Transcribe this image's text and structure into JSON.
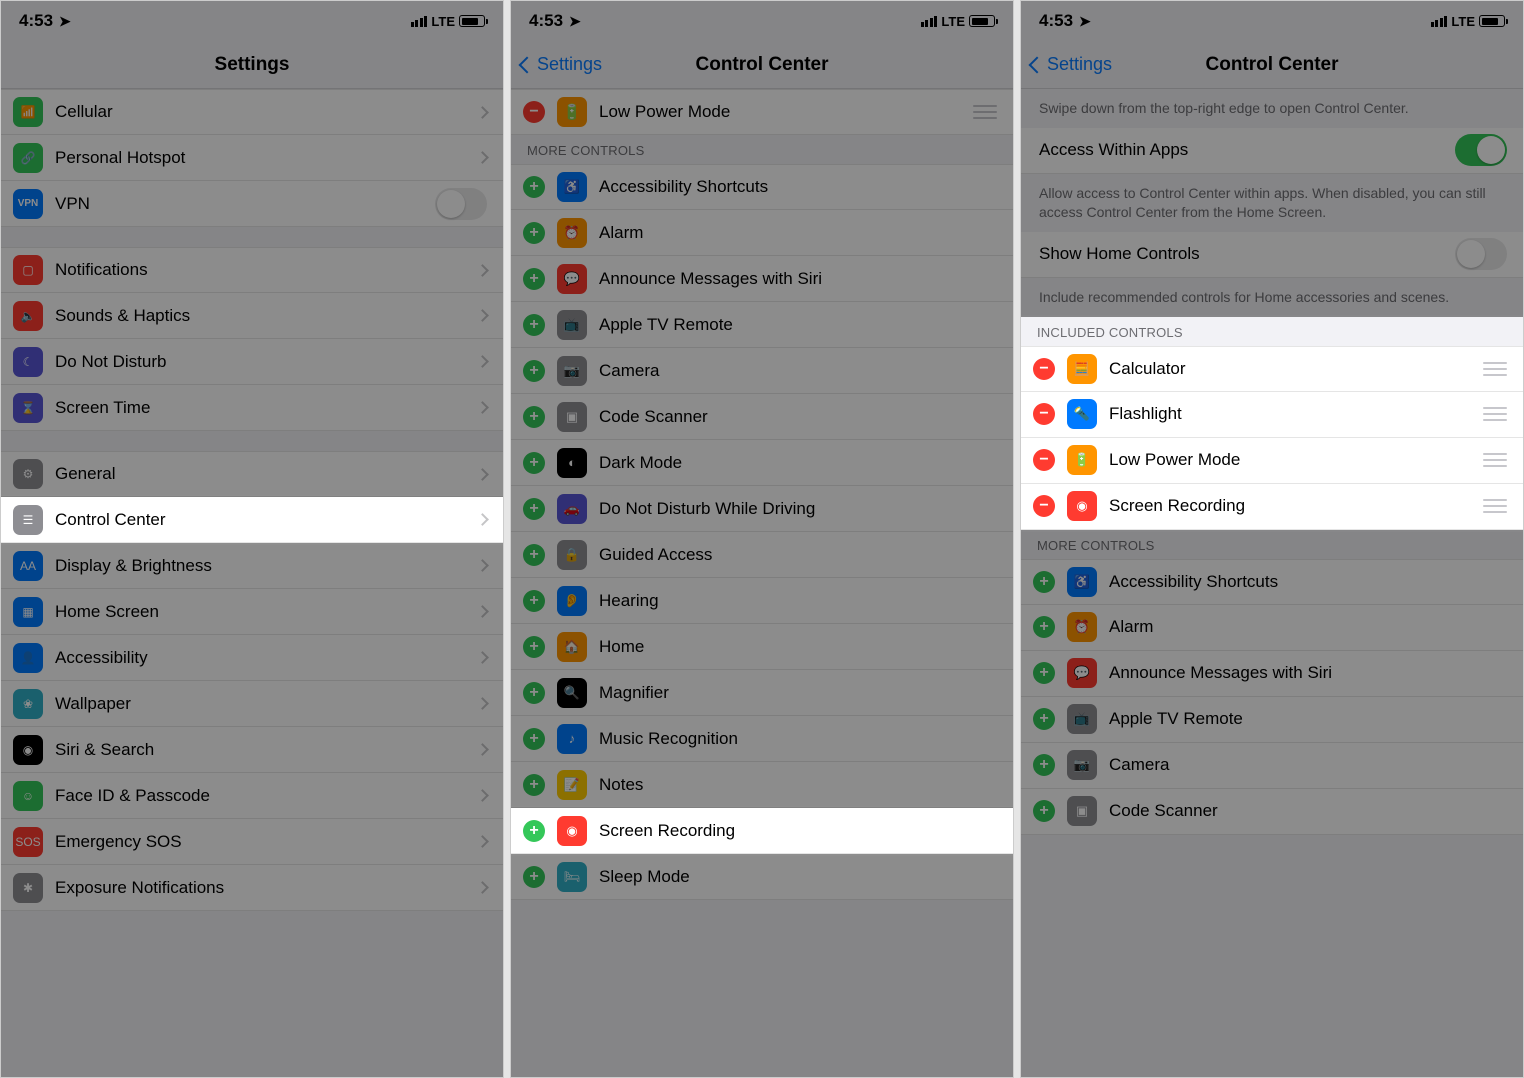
{
  "statusbar": {
    "time": "4:53",
    "network": "LTE"
  },
  "phone1": {
    "title": "Settings",
    "rows1": [
      {
        "label": "Cellular",
        "icon_bg": "ic-green",
        "glyph": "📶"
      },
      {
        "label": "Personal Hotspot",
        "icon_bg": "ic-green",
        "glyph": "🔗"
      }
    ],
    "vpn_label": "VPN",
    "vpn_glyph": "VPN",
    "rows2": [
      {
        "label": "Notifications",
        "icon_bg": "ic-red",
        "glyph": "▢"
      },
      {
        "label": "Sounds & Haptics",
        "icon_bg": "ic-red",
        "glyph": "🔈"
      },
      {
        "label": "Do Not Disturb",
        "icon_bg": "ic-purple",
        "glyph": "☾"
      },
      {
        "label": "Screen Time",
        "icon_bg": "ic-purple",
        "glyph": "⌛"
      }
    ],
    "rows3": [
      {
        "label": "General",
        "icon_bg": "ic-grey",
        "glyph": "⚙"
      },
      {
        "label": "Control Center",
        "icon_bg": "ic-grey",
        "glyph": "☰"
      },
      {
        "label": "Display & Brightness",
        "icon_bg": "ic-blue",
        "glyph": "AA"
      },
      {
        "label": "Home Screen",
        "icon_bg": "ic-blue",
        "glyph": "▦"
      },
      {
        "label": "Accessibility",
        "icon_bg": "ic-blue",
        "glyph": "👤"
      },
      {
        "label": "Wallpaper",
        "icon_bg": "ic-teal",
        "glyph": "❀"
      },
      {
        "label": "Siri & Search",
        "icon_bg": "ic-black",
        "glyph": "◉"
      },
      {
        "label": "Face ID & Passcode",
        "icon_bg": "ic-green",
        "glyph": "☺"
      },
      {
        "label": "Emergency SOS",
        "icon_bg": "ic-red",
        "glyph": "SOS"
      },
      {
        "label": "Exposure Notifications",
        "icon_bg": "ic-grey",
        "glyph": "✱"
      }
    ],
    "highlight_index": 1
  },
  "phone2": {
    "back_label": "Settings",
    "title": "Control Center",
    "included_tail": {
      "label": "Low Power Mode",
      "icon_bg": "ic-orange",
      "glyph": "🔋"
    },
    "more_header": "MORE CONTROLS",
    "more": [
      {
        "label": "Accessibility Shortcuts",
        "icon_bg": "ic-blue",
        "glyph": "♿"
      },
      {
        "label": "Alarm",
        "icon_bg": "ic-orange",
        "glyph": "⏰"
      },
      {
        "label": "Announce Messages with Siri",
        "icon_bg": "ic-red",
        "glyph": "💬"
      },
      {
        "label": "Apple TV Remote",
        "icon_bg": "ic-grey",
        "glyph": "📺"
      },
      {
        "label": "Camera",
        "icon_bg": "ic-grey",
        "glyph": "📷"
      },
      {
        "label": "Code Scanner",
        "icon_bg": "ic-grey",
        "glyph": "▣"
      },
      {
        "label": "Dark Mode",
        "icon_bg": "ic-black",
        "glyph": "◐"
      },
      {
        "label": "Do Not Disturb While Driving",
        "icon_bg": "ic-purple",
        "glyph": "🚗"
      },
      {
        "label": "Guided Access",
        "icon_bg": "ic-grey",
        "glyph": "🔒"
      },
      {
        "label": "Hearing",
        "icon_bg": "ic-blue",
        "glyph": "👂"
      },
      {
        "label": "Home",
        "icon_bg": "ic-orange",
        "glyph": "🏠"
      },
      {
        "label": "Magnifier",
        "icon_bg": "ic-black",
        "glyph": "🔍"
      },
      {
        "label": "Music Recognition",
        "icon_bg": "ic-blue",
        "glyph": "♪"
      },
      {
        "label": "Notes",
        "icon_bg": "ic-yellow",
        "glyph": "📝"
      },
      {
        "label": "Screen Recording",
        "icon_bg": "ic-red",
        "glyph": "◉"
      },
      {
        "label": "Sleep Mode",
        "icon_bg": "ic-teal",
        "glyph": "🛏"
      }
    ],
    "highlight_index": 14
  },
  "phone3": {
    "back_label": "Settings",
    "title": "Control Center",
    "swipe_desc": "Swipe down from the top-right edge to open Control Center.",
    "access_label": "Access Within Apps",
    "access_desc": "Allow access to Control Center within apps. When disabled, you can still access Control Center from the Home Screen.",
    "home_label": "Show Home Controls",
    "home_desc": "Include recommended controls for Home accessories and scenes.",
    "included_header": "INCLUDED CONTROLS",
    "included": [
      {
        "label": "Calculator",
        "icon_bg": "ic-orange",
        "glyph": "🧮"
      },
      {
        "label": "Flashlight",
        "icon_bg": "ic-blue",
        "glyph": "🔦"
      },
      {
        "label": "Low Power Mode",
        "icon_bg": "ic-orange",
        "glyph": "🔋"
      },
      {
        "label": "Screen Recording",
        "icon_bg": "ic-red",
        "glyph": "◉"
      }
    ],
    "more_header": "MORE CONTROLS",
    "more": [
      {
        "label": "Accessibility Shortcuts",
        "icon_bg": "ic-blue",
        "glyph": "♿"
      },
      {
        "label": "Alarm",
        "icon_bg": "ic-orange",
        "glyph": "⏰"
      },
      {
        "label": "Announce Messages with Siri",
        "icon_bg": "ic-red",
        "glyph": "💬"
      },
      {
        "label": "Apple TV Remote",
        "icon_bg": "ic-grey",
        "glyph": "📺"
      },
      {
        "label": "Camera",
        "icon_bg": "ic-grey",
        "glyph": "📷"
      },
      {
        "label": "Code Scanner",
        "icon_bg": "ic-grey",
        "glyph": "▣"
      }
    ]
  }
}
